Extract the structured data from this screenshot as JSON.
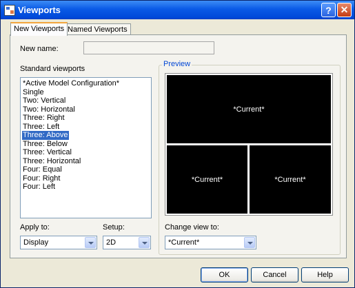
{
  "window": {
    "title": "Viewports"
  },
  "tabs": [
    {
      "label": "New Viewports",
      "active": true
    },
    {
      "label": "Named Viewports",
      "active": false
    }
  ],
  "new_name": {
    "label": "New name:",
    "value": ""
  },
  "standard_viewports": {
    "label": "Standard viewports",
    "items": [
      "*Active Model Configuration*",
      "Single",
      "Two:  Vertical",
      "Two:  Horizontal",
      "Three: Right",
      "Three: Left",
      "Three: Above",
      "Three: Below",
      "Three: Vertical",
      "Three: Horizontal",
      "Four: Equal",
      "Four: Right",
      "Four: Left"
    ],
    "selected": "Three: Above"
  },
  "preview": {
    "label": "Preview",
    "viewports": [
      "*Current*",
      "*Current*",
      "*Current*"
    ]
  },
  "apply_to": {
    "label": "Apply to:",
    "value": "Display"
  },
  "setup": {
    "label": "Setup:",
    "value": "2D"
  },
  "change_view_to": {
    "label": "Change view to:",
    "value": "*Current*"
  },
  "buttons": {
    "ok": "OK",
    "cancel": "Cancel",
    "help": "Help"
  },
  "colors": {
    "titlebar": "#0a5ae6",
    "selection": "#316ac5",
    "preview_bg": "#000000",
    "group_label": "#0046d5"
  }
}
